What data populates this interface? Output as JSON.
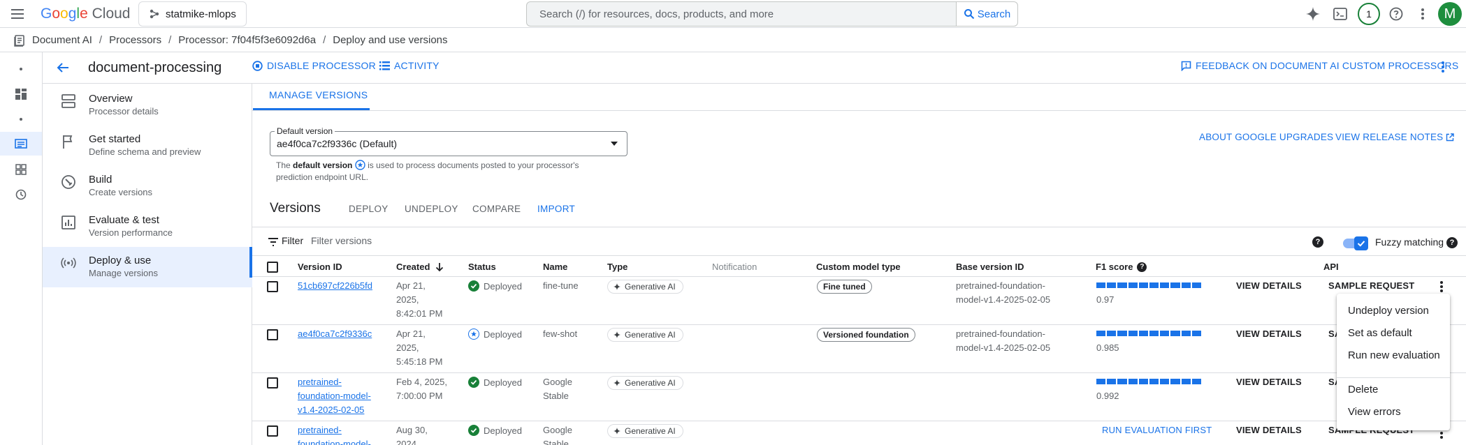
{
  "topbar": {
    "logo_letters": [
      "G",
      "o",
      "o",
      "g",
      "l",
      "e"
    ],
    "logo_product": "Cloud",
    "project_name": "statmike-mlops",
    "search_placeholder": "Search (/) for resources, docs, products, and more",
    "search_button": "Search",
    "notification_count": "1",
    "avatar_letter": "M"
  },
  "breadcrumb": {
    "items": [
      "Document AI",
      "Processors",
      "Processor: 7f04f5f3e6092d6a",
      "Deploy and use versions"
    ],
    "separator": "/"
  },
  "header": {
    "title": "document-processing",
    "disable_processor": "DISABLE PROCESSOR",
    "activity": "ACTIVITY",
    "feedback": "FEEDBACK ON DOCUMENT AI CUSTOM PROCESSORS"
  },
  "sidenav": {
    "items": [
      {
        "title": "Overview",
        "subtitle": "Processor details"
      },
      {
        "title": "Get started",
        "subtitle": "Define schema and preview"
      },
      {
        "title": "Build",
        "subtitle": "Create versions"
      },
      {
        "title": "Evaluate & test",
        "subtitle": "Version performance"
      },
      {
        "title": "Deploy & use",
        "subtitle": "Manage versions"
      }
    ],
    "active_index": 4
  },
  "tabs": {
    "manage_versions": "MANAGE VERSIONS"
  },
  "default_version": {
    "label": "Default version",
    "value": "ae4f0ca7c2f9336c (Default)",
    "help_prefix": "The",
    "help_bold": "default version",
    "help_suffix": "is used to process documents posted to your processor's prediction endpoint URL.",
    "about_upgrades": "ABOUT GOOGLE UPGRADES",
    "release_notes": "VIEW RELEASE NOTES"
  },
  "versions": {
    "title": "Versions",
    "actions": {
      "deploy": "DEPLOY",
      "undeploy": "UNDEPLOY",
      "compare": "COMPARE",
      "import": "IMPORT"
    },
    "filter_label": "Filter",
    "filter_placeholder": "Filter versions",
    "fuzzy_matching": "Fuzzy matching",
    "fuzzy_enabled": true,
    "help_glyph": "?"
  },
  "table": {
    "columns": {
      "version_id": "Version ID",
      "created": "Created",
      "status": "Status",
      "name": "Name",
      "type": "Type",
      "notification": "Notification",
      "custom_model_type": "Custom model type",
      "base_version_id": "Base version ID",
      "f1_score": "F1 score",
      "api": "API"
    },
    "rows": [
      {
        "version_id_lines": [
          "51cb697cf226b5fd"
        ],
        "created_lines": [
          "Apr 21,",
          "2025,",
          "8:42:01 PM"
        ],
        "status": "Deployed",
        "status_kind": "check",
        "name_lines": [
          "fine-tune"
        ],
        "type": "Generative AI",
        "custom_model_type": "Fine tuned",
        "base_version_lines": [
          "pretrained-foundation-",
          "model-v1.4-2025-02-05"
        ],
        "f1_score": "0.97",
        "f1_fraction": 0.97,
        "view_details": "VIEW DETAILS",
        "sample_request": "SAMPLE REQUEST"
      },
      {
        "version_id_lines": [
          "ae4f0ca7c2f9336c"
        ],
        "created_lines": [
          "Apr 21,",
          "2025,",
          "5:45:18 PM"
        ],
        "status": "Deployed",
        "status_kind": "default",
        "name_lines": [
          "few-shot"
        ],
        "type": "Generative AI",
        "custom_model_type": "Versioned foundation",
        "base_version_lines": [
          "pretrained-foundation-",
          "model-v1.4-2025-02-05"
        ],
        "f1_score": "0.985",
        "f1_fraction": 0.985,
        "view_details": "VIEW DETAILS",
        "sample_request": "SA"
      },
      {
        "version_id_lines": [
          "pretrained-",
          "foundation-model-",
          "v1.4-2025-02-05"
        ],
        "created_lines": [
          "Feb 4, 2025,",
          "7:00:00 PM"
        ],
        "status": "Deployed",
        "status_kind": "check",
        "name_lines": [
          "Google",
          "Stable"
        ],
        "type": "Generative AI",
        "custom_model_type": "",
        "base_version_lines": [],
        "f1_score": "0.992",
        "f1_fraction": 0.992,
        "view_details": "VIEW DETAILS",
        "sample_request": "SA"
      },
      {
        "version_id_lines": [
          "pretrained-",
          "foundation-model-"
        ],
        "created_lines": [
          "Aug 30,",
          "2024"
        ],
        "status": "Deployed",
        "status_kind": "check",
        "name_lines": [
          "Google",
          "Stable"
        ],
        "type": "Generative AI",
        "custom_model_type": "",
        "base_version_lines": [],
        "f1_link": "RUN EVALUATION FIRST",
        "view_details": "VIEW DETAILS",
        "sample_request": "SAMPLE REQUEST"
      }
    ]
  },
  "context_menu": {
    "items": [
      "Undeploy version",
      "Set as default",
      "Run new evaluation",
      "Delete",
      "View errors"
    ]
  },
  "colors": {
    "accent": "#1a73e8",
    "deployed_green": "#188038",
    "divider": "#dadce0",
    "active_nav_bg": "#e8f0fe"
  }
}
